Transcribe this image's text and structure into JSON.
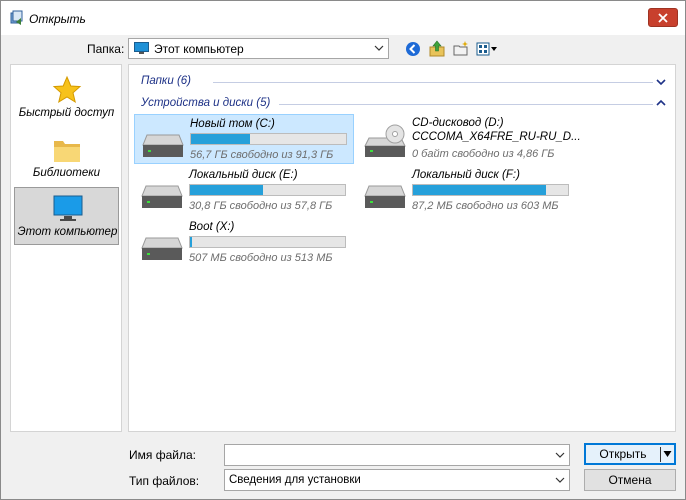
{
  "dialog": {
    "title": "Открыть"
  },
  "toolbar": {
    "folder_label": "Папка:",
    "location": "Этот компьютер"
  },
  "sidebar": {
    "items": [
      {
        "label": "Быстрый доступ",
        "icon": "star-icon"
      },
      {
        "label": "Библиотеки",
        "icon": "folder-icon"
      },
      {
        "label": "Этот компьютер",
        "icon": "monitor-icon",
        "active": true
      }
    ]
  },
  "content": {
    "groups": [
      {
        "label": "Папки (6)",
        "collapsed": true
      },
      {
        "label": "Устройства и диски (5)",
        "collapsed": false
      }
    ],
    "drives": [
      {
        "name": "Новый том (C:)",
        "info": "56,7 ГБ свободно из 91,3 ГБ",
        "used_fraction": 0.38,
        "selected": true
      },
      {
        "name": "CD-дисковод (D:)",
        "name2": "CCCOMA_X64FRE_RU-RU_D...",
        "info": "0 байт свободно из 4,86 ГБ"
      },
      {
        "name": "Локальный диск (E:)",
        "info": "30,8 ГБ свободно из 57,8 ГБ",
        "used_fraction": 0.47
      },
      {
        "name": "Локальный диск (F:)",
        "info": "87,2 МБ свободно из 603 МБ",
        "used_fraction": 0.86
      },
      {
        "name": "Boot (X:)",
        "info": "507 МБ свободно из 513 МБ",
        "used_fraction": 0.012
      }
    ]
  },
  "footer": {
    "filename_label": "Имя файла:",
    "filename_value": "",
    "filetype_label": "Тип файлов:",
    "filetype_value": "Сведения для установки",
    "open_label": "Открыть",
    "cancel_label": "Отмена"
  },
  "colors": {
    "accent": "#0078d7",
    "bar_fill": "#26a0da",
    "selection": "#cce8ff",
    "close": "#c8402d",
    "group_header": "#1e3287"
  }
}
